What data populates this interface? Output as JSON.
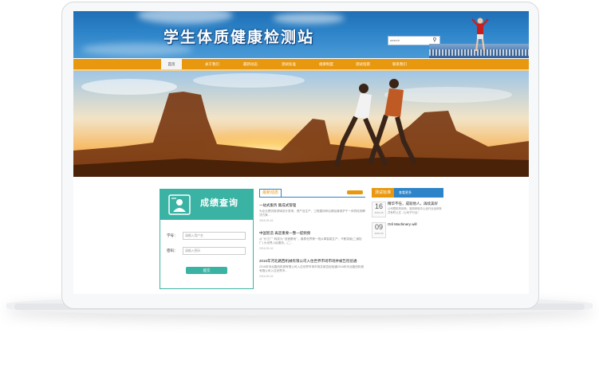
{
  "site": {
    "title": "学生体质健康检测站",
    "search_placeholder": "search",
    "search_icon": "magnifier-icon"
  },
  "nav": {
    "items": [
      {
        "label": "首页",
        "active": true
      },
      {
        "label": "关于我们",
        "active": false
      },
      {
        "label": "最新动态",
        "active": false
      },
      {
        "label": "测试标准",
        "active": false
      },
      {
        "label": "规章制度",
        "active": false
      },
      {
        "label": "测试指南",
        "active": false
      },
      {
        "label": "联系我们",
        "active": false
      }
    ]
  },
  "banner": {
    "slides": 2,
    "active_slide": 1
  },
  "score": {
    "title": "成绩查询",
    "fields": [
      {
        "label": "学号：",
        "placeholder": "请输入用户名"
      },
      {
        "label": "密码：",
        "placeholder": "请输入密码"
      }
    ],
    "submit_label": "提交"
  },
  "news": {
    "tab_label": "最新动态",
    "items": [
      {
        "title": "一站式服务 集成式管理",
        "desc": "为企业提供各领域设计咨询、资产及生产、工程建设和后期运营维护于一体的检测解决方案...",
        "date": "2016-09-16"
      },
      {
        "title": "中国智造 再迎重要一整一提频频",
        "desc": "从 “长江厂” 转变为 “创造基地” ，鼎泰世界第一批从事智能生产、不断突破(二道检厂) 为世界人民服务。(二...",
        "date": "2016-09-16"
      },
      {
        "title": "2016年河北路西机械有限公司入住世界市场市场并被告检验通",
        "desc": "2016年河北路西机械有限公司入住世界市场市场并被告检验通2016年河北路西机械有限公司入住世界市...",
        "date": "2016-09-16"
      }
    ]
  },
  "side": {
    "tab_label": "测试标准",
    "tab2_label": "查看更多",
    "items": [
      {
        "day": "16",
        "ym": "2016-09",
        "title": "精华不任，成就他人，再续美好",
        "desc": "公司是机构体系，准则体验中心全行业全体系并有时公文（公司子行业）"
      },
      {
        "day": "09",
        "ym": "2016-09",
        "title": "Oril Machinery will",
        "desc": ""
      }
    ]
  },
  "colors": {
    "header_blue": "#2d84c9",
    "nav_orange": "#e8980f",
    "teal": "#3bb3a4"
  }
}
